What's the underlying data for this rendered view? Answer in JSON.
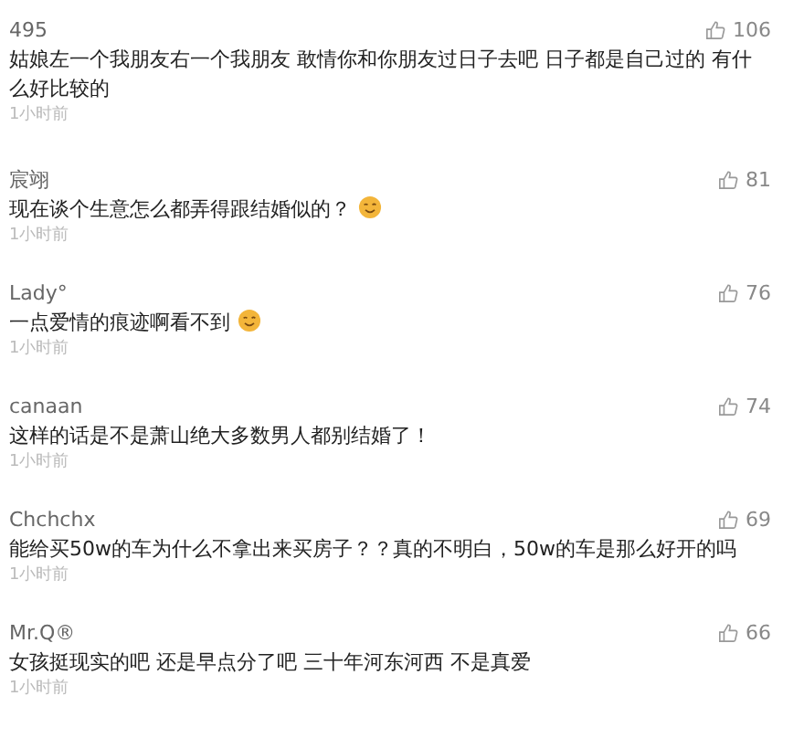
{
  "comments": [
    {
      "user": "495",
      "likes": "106",
      "text": "姑娘左一个我朋友右一个我朋友 敢情你和你朋友过日子去吧 日子都是自己过的 有什么好比较的",
      "emoji": false,
      "time": "1小时前"
    },
    {
      "user": "宸翊",
      "likes": "81",
      "text": "现在谈个生意怎么都弄得跟结婚似的？",
      "emoji": true,
      "time": "1小时前"
    },
    {
      "user": "Lady°",
      "likes": "76",
      "text": "一点爱情的痕迹啊看不到",
      "emoji": true,
      "time": "1小时前"
    },
    {
      "user": "canaan",
      "likes": "74",
      "text": "这样的话是不是萧山绝大多数男人都别结婚了！",
      "emoji": false,
      "time": "1小时前"
    },
    {
      "user": "Chchchx",
      "likes": "69",
      "text": "能给买50w的车为什么不拿出来买房子？？真的不明白，50w的车是那么好开的吗",
      "emoji": false,
      "time": "1小时前"
    },
    {
      "user": "Mr.Q®",
      "likes": "66",
      "text": "女孩挺现实的吧 还是早点分了吧 三十年河东河西 不是真爱",
      "emoji": false,
      "time": "1小时前"
    }
  ]
}
